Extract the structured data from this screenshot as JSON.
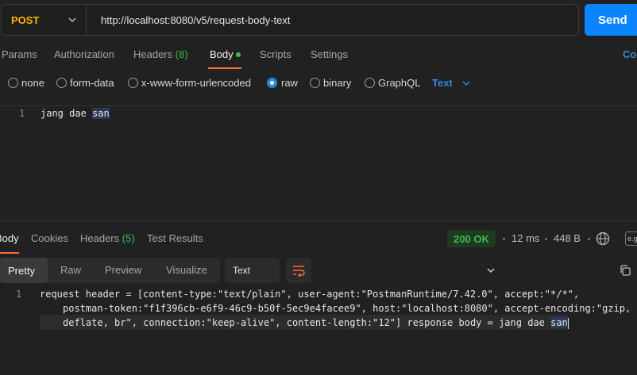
{
  "request": {
    "method": "POST",
    "url": "http://localhost:8080/v5/request-body-text",
    "send_label": "Send"
  },
  "request_tabs": {
    "params": "Params",
    "authorization": "Authorization",
    "headers": "Headers",
    "headers_count": "(8)",
    "body": "Body",
    "scripts": "Scripts",
    "settings": "Settings",
    "cookies": "Coo"
  },
  "body_types": {
    "none": "none",
    "form_data": "form-data",
    "urlencoded": "x-www-form-urlencoded",
    "raw": "raw",
    "binary": "binary",
    "graphql": "GraphQL",
    "selected": "raw",
    "format": "Text"
  },
  "editor": {
    "line_number": "1",
    "text_before": "jang dae ",
    "text_selected": "san"
  },
  "response_tabs": {
    "body": "Body",
    "cookies": "Cookies",
    "headers": "Headers",
    "headers_count": "(5)",
    "test_results": "Test Results"
  },
  "response_meta": {
    "status": "200 OK",
    "time": "12 ms",
    "size": "448 B",
    "save_label": "e.g"
  },
  "view_options": {
    "pretty": "Pretty",
    "raw": "Raw",
    "preview": "Preview",
    "visualize": "Visualize",
    "language": "Text"
  },
  "response_body": {
    "line_number": "1",
    "line1": "request header = [content-type:\"text/plain\", user-agent:\"PostmanRuntime/7.42.0\", accept:\"*/*\",",
    "line2": "postman-token:\"f1f396cb-e6f9-46c9-b50f-5ec9e4facee9\", host:\"localhost:8080\", accept-encoding:\"gzip,",
    "line3_before": "deflate, br\", connection:\"keep-alive\", content-length:\"12\"] response body = jang dae ",
    "line3_selected": "san"
  },
  "colors": {
    "accent": "#0a84ff",
    "method": "#ffb400",
    "success": "#3fb950",
    "active_underline": "#ff6c37",
    "link": "#2b8bdb"
  }
}
